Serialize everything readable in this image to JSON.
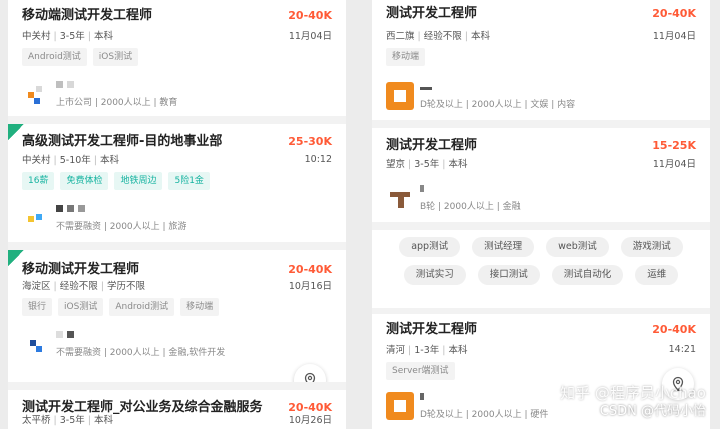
{
  "left_jobs": [
    {
      "title": "移动端测试开发工程师",
      "salary": "20-40K",
      "location": "中关村",
      "experience": "3-5年",
      "education": "本科",
      "date": "11月04日",
      "tags": [
        "Android测试",
        "iOS测试"
      ],
      "company_desc": "上市公司 | 2000人以上 | 教育"
    },
    {
      "title": "高级测试开发工程师-目的地事业部",
      "salary": "25-30K",
      "location": "中关村",
      "experience": "5-10年",
      "education": "本科",
      "date": "10:12",
      "tags": [
        "16薪",
        "免费体检",
        "地铁周边",
        "5险1金"
      ],
      "company_desc": "不需要融资 | 2000人以上 | 旅游"
    },
    {
      "title": "移动测试开发工程师",
      "salary": "20-40K",
      "location": "海淀区",
      "experience": "经验不限",
      "education": "学历不限",
      "date": "10月16日",
      "tags": [
        "银行",
        "iOS测试",
        "Android测试",
        "移动端"
      ],
      "company_desc": "不需要融资 | 2000人以上 | 金融,软件开发"
    },
    {
      "title": "测试开发工程师_对公业务及综合金融服务",
      "salary": "20-40K",
      "location": "太平桥",
      "experience": "3-5年",
      "education": "本科",
      "date": "10月26日"
    }
  ],
  "right_jobs": [
    {
      "title": "测试开发工程师",
      "salary": "20-40K",
      "location": "西二旗",
      "experience": "经验不限",
      "education": "本科",
      "date": "11月04日",
      "tags": [
        "移动端"
      ],
      "company_desc": "D轮及以上 | 2000人以上 | 文娱 | 内容"
    },
    {
      "title": "测试开发工程师",
      "salary": "15-25K",
      "location": "望京",
      "experience": "3-5年",
      "education": "本科",
      "date": "11月04日",
      "company_desc": "B轮 | 2000人以上 | 金融"
    },
    {
      "title": "测试开发工程师",
      "salary": "20-40K",
      "location": "清河",
      "experience": "1-3年",
      "education": "本科",
      "date": "14:21",
      "tags": [
        "Server端测试"
      ],
      "company_desc": "D轮及以上 | 2000人以上 | 硬件"
    }
  ],
  "skill_chips": {
    "row1": [
      "app测试",
      "测试经理",
      "web测试",
      "游戏测试"
    ],
    "row2": [
      "测试实习",
      "接口测试",
      "测试自动化",
      "运维"
    ]
  },
  "watermark": {
    "line1": "知乎 @程序员小chao",
    "line2": "CSDN @代码小怡"
  },
  "colors": {
    "salary": "#ff5a36",
    "accent_green": "#16b3a0",
    "logo_orange": "#f08a1e"
  },
  "icons": {
    "map": "map-pin-icon",
    "badge": "new-badge-icon"
  }
}
